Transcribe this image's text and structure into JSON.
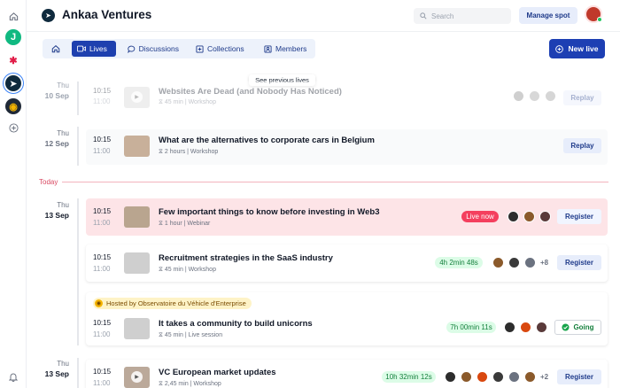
{
  "header": {
    "title": "Ankaa Ventures",
    "search_placeholder": "Search",
    "manage_label": "Manage spot"
  },
  "tabs": [
    {
      "label": ""
    },
    {
      "label": "Lives"
    },
    {
      "label": "Discussions"
    },
    {
      "label": "Collections"
    },
    {
      "label": "Members"
    }
  ],
  "new_live_label": "New live",
  "tooltip": "See previous lives",
  "today_label": "Today",
  "days": [
    {
      "weekday": "Thu",
      "date": "10 Sep"
    },
    {
      "weekday": "Thu",
      "date": "12 Sep"
    },
    {
      "weekday": "Thu",
      "date": "13 Sep"
    },
    {
      "weekday": "Thu",
      "date": "13 Sep"
    }
  ],
  "events": [
    {
      "start": "10:15",
      "end": "11:00",
      "title": "Websites Are Dead (and Nobody Has Noticed)",
      "meta": "45 min | Workshop",
      "action": "Replay"
    },
    {
      "start": "10:15",
      "end": "11:00",
      "title": "What are the alternatives to corporate cars in Belgium",
      "meta": "2 hours | Workshop",
      "action": "Replay"
    },
    {
      "start": "10:15",
      "end": "11:00",
      "title": "Few important things to know before investing in Web3",
      "meta": "1 hour | Webinar",
      "status": "Live now",
      "action": "Register"
    },
    {
      "start": "10:15",
      "end": "11:00",
      "title": "Recruitment strategies in the SaaS industry",
      "meta": "45 min | Workshop",
      "status": "4h 2min 48s",
      "more": "+8",
      "action": "Register"
    },
    {
      "start": "10:15",
      "end": "11:00",
      "host": "Hosted by Observatoire du Véhicle d'Enterprise",
      "title": "It takes a community to build unicorns",
      "meta": "45 min | Live session",
      "status": "7h 00min 11s",
      "action": "Going"
    },
    {
      "start": "10:15",
      "end": "11:00",
      "title": "VC European market updates",
      "meta": "2,45 min | Workshop",
      "status": "10h 32min 12s",
      "more": "+2",
      "action": "Register"
    }
  ],
  "colors": {
    "primary": "#1d3fb3",
    "live": "#f43f5e",
    "today": "#d94a63",
    "countdown": "#15803d"
  }
}
